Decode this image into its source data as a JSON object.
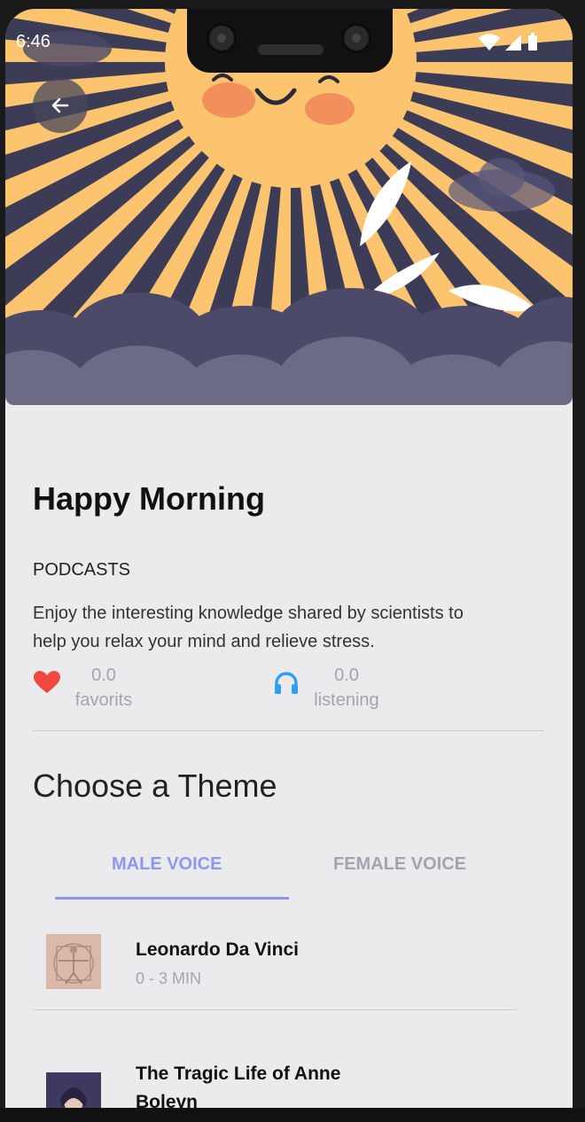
{
  "status_bar": {
    "time": "6:46"
  },
  "podcast": {
    "title": "Happy Morning",
    "category": "PODCASTS",
    "description": "Enjoy the interesting knowledge shared by scientists to help you relax your mind and relieve stress.",
    "favorites": {
      "value": "0.0",
      "label": "favorits"
    },
    "listening": {
      "value": "0.0",
      "label": "listening"
    }
  },
  "theme_section": {
    "title": "Choose a Theme"
  },
  "tabs": [
    {
      "label": "MALE VOICE",
      "active": true
    },
    {
      "label": "FEMALE VOICE",
      "active": false
    }
  ],
  "items": [
    {
      "title": "Leonardo Da Vinci",
      "duration": "0 - 3 MIN"
    },
    {
      "title": "The Tragic Life of Anne Boleyn",
      "duration": ""
    }
  ],
  "colors": {
    "accent": "#8e97f0",
    "inactive_tab": "#a4a4ae",
    "heart": "#f0483e",
    "headphones": "#2f9ef3",
    "hero_bg": "#3d3c57",
    "sun": "#fcc46f"
  },
  "icons": {
    "back": "arrow-left-icon",
    "favorites": "heart-icon",
    "listening": "headphones-icon"
  }
}
